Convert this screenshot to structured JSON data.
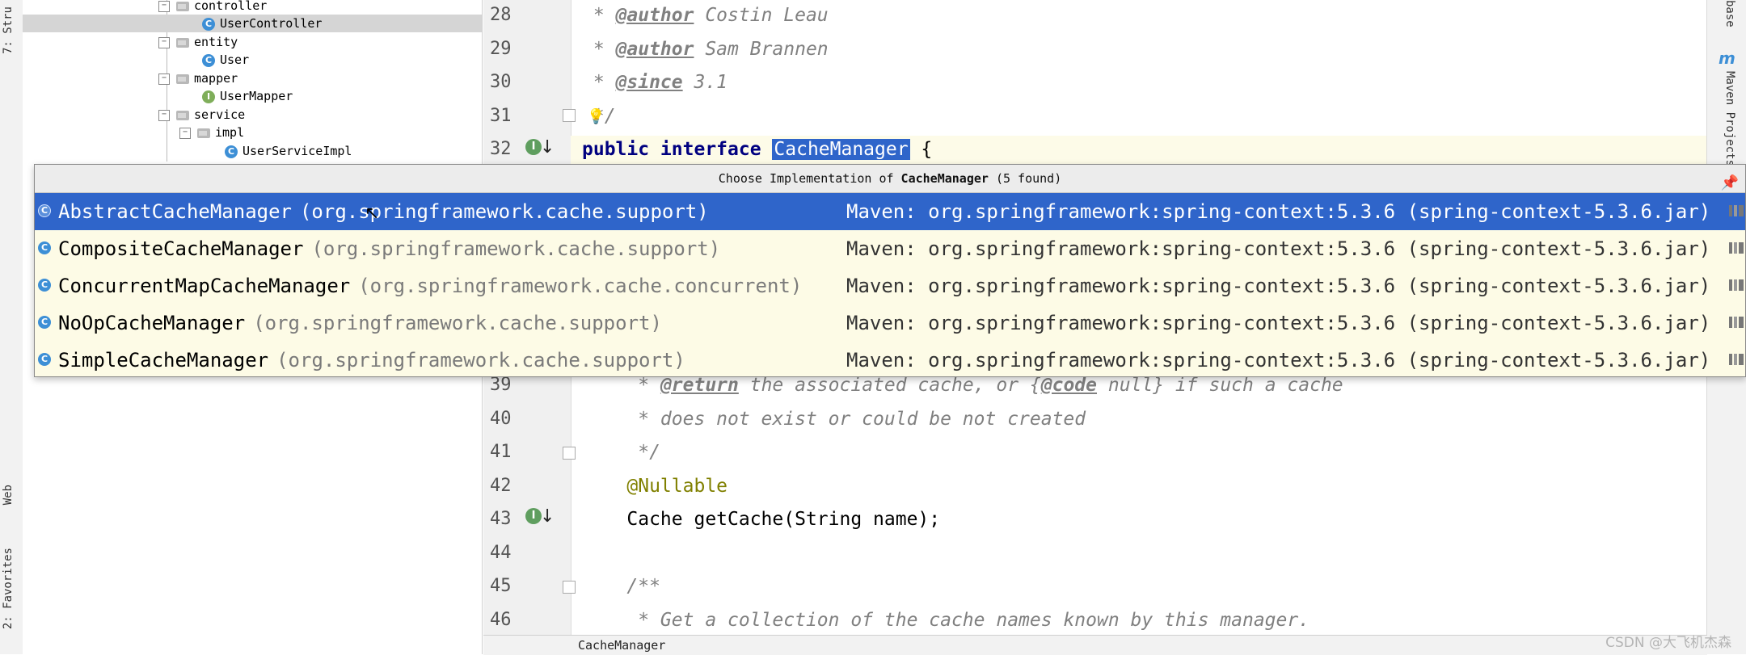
{
  "left_strip": {
    "tabs": [
      {
        "label": "7: Stru"
      },
      {
        "label": "Web"
      },
      {
        "label": "2: Favorites"
      }
    ]
  },
  "right_strip": {
    "tabs": [
      {
        "label": "base"
      },
      {
        "label": "Maven Projects"
      }
    ]
  },
  "tree": {
    "items": [
      {
        "label": "controller",
        "kind": "folder"
      },
      {
        "label": "UserController",
        "kind": "class",
        "selected": true
      },
      {
        "label": "entity",
        "kind": "folder"
      },
      {
        "label": "User",
        "kind": "class"
      },
      {
        "label": "mapper",
        "kind": "folder"
      },
      {
        "label": "UserMapper",
        "kind": "interface"
      },
      {
        "label": "service",
        "kind": "folder"
      },
      {
        "label": "impl",
        "kind": "folder"
      },
      {
        "label": "UserServiceImpl",
        "kind": "class"
      }
    ],
    "icon_class": "C",
    "icon_interface": "I"
  },
  "editor": {
    "lines_top": [
      {
        "num": "28",
        "parts": [
          {
            "t": " * ",
            "c": "cmt"
          },
          {
            "t": "@author",
            "c": "tag"
          },
          {
            "t": " Costin Leau",
            "c": "cmt"
          }
        ]
      },
      {
        "num": "29",
        "parts": [
          {
            "t": " * ",
            "c": "cmt"
          },
          {
            "t": "@author",
            "c": "tag"
          },
          {
            "t": " Sam Brannen",
            "c": "cmt"
          }
        ]
      },
      {
        "num": "30",
        "parts": [
          {
            "t": " * ",
            "c": "cmt"
          },
          {
            "t": "@since",
            "c": "tag"
          },
          {
            "t": " 3.1",
            "c": "cmt"
          }
        ]
      },
      {
        "num": "31",
        "parts": [
          {
            "t": " */",
            "c": "cmt"
          }
        ]
      },
      {
        "num": "32",
        "parts": [
          {
            "t": "public interface ",
            "c": "kw"
          },
          {
            "t": "CacheManager",
            "c": "hl"
          },
          {
            "t": " {",
            "c": ""
          }
        ]
      }
    ],
    "lines_bottom": [
      {
        "num": "39",
        "parts": [
          {
            "t": "     * ",
            "c": "cmt"
          },
          {
            "t": "@return",
            "c": "tag"
          },
          {
            "t": " the associated cache, or {",
            "c": "cmt"
          },
          {
            "t": "@code",
            "c": "tag"
          },
          {
            "t": " null} if such a cache",
            "c": "cmt"
          }
        ]
      },
      {
        "num": "40",
        "parts": [
          {
            "t": "     * does not exist or could be not created",
            "c": "cmt"
          }
        ]
      },
      {
        "num": "41",
        "parts": [
          {
            "t": "     */",
            "c": "cmt"
          }
        ]
      },
      {
        "num": "42",
        "parts": [
          {
            "t": "    @Nullable",
            "c": "ann"
          }
        ]
      },
      {
        "num": "43",
        "parts": [
          {
            "t": "    Cache getCache(String name);",
            "c": ""
          }
        ]
      },
      {
        "num": "44",
        "parts": [
          {
            "t": "",
            "c": ""
          }
        ]
      },
      {
        "num": "45",
        "parts": [
          {
            "t": "    /**",
            "c": "cmt"
          }
        ]
      },
      {
        "num": "46",
        "parts": [
          {
            "t": "     * Get a collection of the cache names known by this manager.",
            "c": "cmt"
          }
        ]
      }
    ],
    "gutter_icon": "I",
    "gutter_arrow": "↓"
  },
  "popup": {
    "title_prefix": "Choose Implementation of ",
    "title_name": "CacheManager",
    "title_suffix": " (5 found)",
    "pin_icon": "📌",
    "items": [
      {
        "name": "AbstractCacheManager",
        "pkg": "(org.springframework.cache.support)",
        "maven": "Maven: org.springframework:spring-context:5.3.6 (spring-context-5.3.6.jar)",
        "selected": true
      },
      {
        "name": "CompositeCacheManager",
        "pkg": "(org.springframework.cache.support)",
        "maven": "Maven: org.springframework:spring-context:5.3.6 (spring-context-5.3.6.jar)"
      },
      {
        "name": "ConcurrentMapCacheManager",
        "pkg": "(org.springframework.cache.concurrent)",
        "maven": "Maven: org.springframework:spring-context:5.3.6 (spring-context-5.3.6.jar)"
      },
      {
        "name": "NoOpCacheManager",
        "pkg": "(org.springframework.cache.support)",
        "maven": "Maven: org.springframework:spring-context:5.3.6 (spring-context-5.3.6.jar)"
      },
      {
        "name": "SimpleCacheManager",
        "pkg": "(org.springframework.cache.support)",
        "maven": "Maven: org.springframework:spring-context:5.3.6 (spring-context-5.3.6.jar)"
      }
    ],
    "item_icon": "C"
  },
  "breadcrumb": {
    "label": "CacheManager"
  },
  "watermark": {
    "label": "CSDN @大飞机杰森"
  },
  "colors": {
    "selection": "#2f65ca",
    "popup_bg": "#fdfbe6",
    "class_icon": "#3d8fd6",
    "interface_icon": "#7fae5a"
  }
}
